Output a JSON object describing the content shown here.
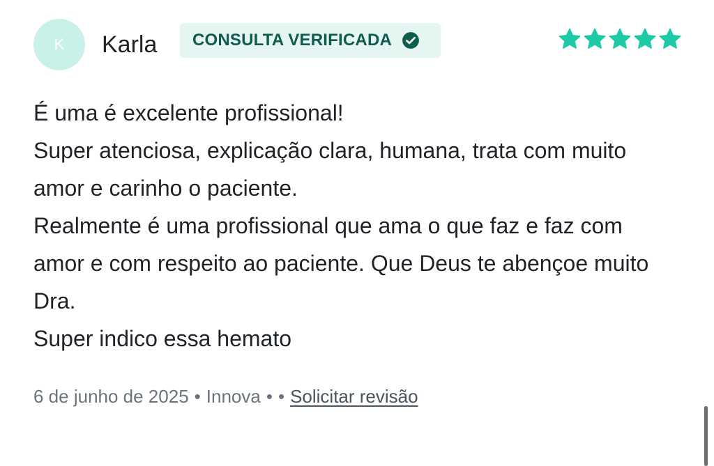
{
  "reviewer": {
    "initial": "K",
    "name": "Karla"
  },
  "badge": {
    "label": "CONSULTA VERIFICADA",
    "icon": "check-circle-icon"
  },
  "rating": {
    "stars": 5,
    "max": 5,
    "color": "#1ec9a8",
    "icon": "star-icon"
  },
  "review": {
    "paragraphs": [
      "É uma é excelente profissional!",
      "Super atenciosa, explicação clara, humana, trata com muito amor e carinho o paciente.",
      "Realmente é uma profissional que ama o que faz e faz com amor e com respeito ao paciente. Que Deus te abençoe muito Dra.",
      "Super indico essa hemato"
    ]
  },
  "footer": {
    "date": "6 de junho de 2025",
    "location": "Innova",
    "separator": "•",
    "request_review_label": "Solicitar revisão"
  },
  "colors": {
    "accent": "#1ec9a8",
    "badge_bg": "#e5f5f2",
    "badge_text": "#0f5c4f",
    "avatar_bg": "#c9f1ea"
  }
}
